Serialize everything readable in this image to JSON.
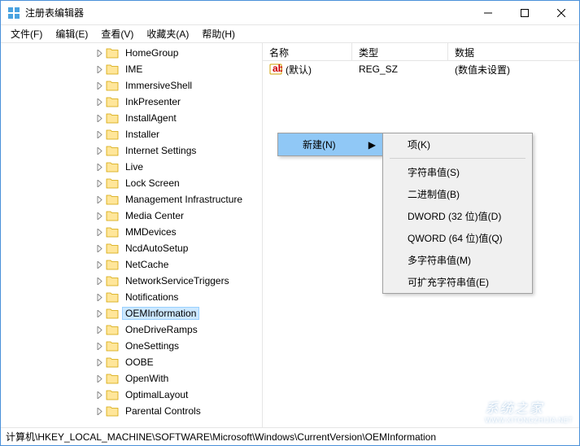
{
  "window": {
    "title": "注册表编辑器"
  },
  "menubar": [
    {
      "label": "文件(F)"
    },
    {
      "label": "编辑(E)"
    },
    {
      "label": "查看(V)"
    },
    {
      "label": "收藏夹(A)"
    },
    {
      "label": "帮助(H)"
    }
  ],
  "tree": {
    "items": [
      {
        "label": "HomeGroup",
        "selected": false
      },
      {
        "label": "IME",
        "selected": false
      },
      {
        "label": "ImmersiveShell",
        "selected": false
      },
      {
        "label": "InkPresenter",
        "selected": false
      },
      {
        "label": "InstallAgent",
        "selected": false
      },
      {
        "label": "Installer",
        "selected": false
      },
      {
        "label": "Internet Settings",
        "selected": false
      },
      {
        "label": "Live",
        "selected": false
      },
      {
        "label": "Lock Screen",
        "selected": false
      },
      {
        "label": "Management Infrastructure",
        "selected": false
      },
      {
        "label": "Media Center",
        "selected": false
      },
      {
        "label": "MMDevices",
        "selected": false
      },
      {
        "label": "NcdAutoSetup",
        "selected": false
      },
      {
        "label": "NetCache",
        "selected": false
      },
      {
        "label": "NetworkServiceTriggers",
        "selected": false
      },
      {
        "label": "Notifications",
        "selected": false
      },
      {
        "label": "OEMInformation",
        "selected": true
      },
      {
        "label": "OneDriveRamps",
        "selected": false
      },
      {
        "label": "OneSettings",
        "selected": false
      },
      {
        "label": "OOBE",
        "selected": false
      },
      {
        "label": "OpenWith",
        "selected": false
      },
      {
        "label": "OptimalLayout",
        "selected": false
      },
      {
        "label": "Parental Controls",
        "selected": false
      }
    ]
  },
  "list": {
    "columns": {
      "name": "名称",
      "type": "类型",
      "data": "数据"
    },
    "rows": [
      {
        "name": "(默认)",
        "type": "REG_SZ",
        "data": "(数值未设置)"
      }
    ]
  },
  "context_menu": {
    "primary": {
      "label": "新建(N)"
    },
    "submenu": [
      {
        "label": "项(K)"
      },
      {
        "label": "字符串值(S)"
      },
      {
        "label": "二进制值(B)"
      },
      {
        "label": "DWORD (32 位)值(D)"
      },
      {
        "label": "QWORD (64 位)值(Q)"
      },
      {
        "label": "多字符串值(M)"
      },
      {
        "label": "可扩充字符串值(E)"
      }
    ]
  },
  "statusbar": {
    "path": "计算机\\HKEY_LOCAL_MACHINE\\SOFTWARE\\Microsoft\\Windows\\CurrentVersion\\OEMInformation"
  },
  "watermark": {
    "text": "系统之家",
    "url": "WWW.XITONGZHIJIA.NET"
  }
}
